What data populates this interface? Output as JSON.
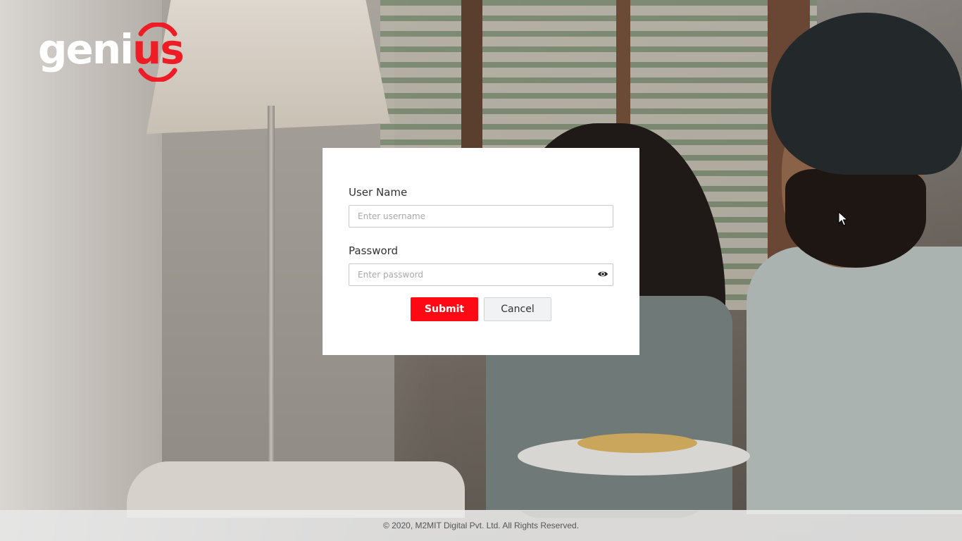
{
  "logo": {
    "text_main": "geni",
    "text_accent": "us",
    "accent_color": "#ee1c25"
  },
  "login": {
    "username_label": "User Name",
    "username_placeholder": "Enter username",
    "username_value": "",
    "password_label": "Password",
    "password_placeholder": "Enter password",
    "password_value": "",
    "password_toggle_icon": "eye-icon",
    "submit_label": "Submit",
    "cancel_label": "Cancel",
    "submit_color": "#ff0a14"
  },
  "footer": {
    "copyright": "© 2020, M2MIT Digital Pvt. Ltd. All Rights Reserved."
  }
}
